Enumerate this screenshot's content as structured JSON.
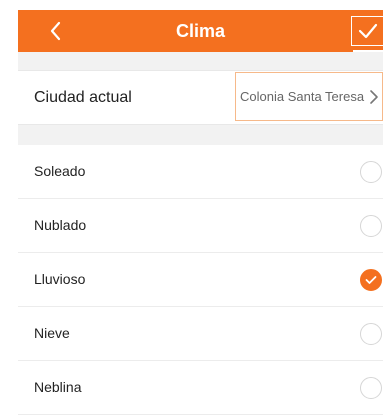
{
  "header": {
    "title": "Clima",
    "back_icon": "chevron-left-icon",
    "confirm_icon": "check-icon",
    "color": "#f4701f"
  },
  "city": {
    "label": "Ciudad actual",
    "value": "Colonia Santa Teresa",
    "chevron_icon": "chevron-right-icon"
  },
  "options": [
    {
      "label": "Soleado",
      "selected": false
    },
    {
      "label": "Nublado",
      "selected": false
    },
    {
      "label": "Lluvioso",
      "selected": true
    },
    {
      "label": "Nieve",
      "selected": false
    },
    {
      "label": "Neblina",
      "selected": false
    }
  ],
  "colors": {
    "accent": "#f4701f",
    "divider": "#f2f2f2",
    "radio_border": "#d6d6d6"
  }
}
